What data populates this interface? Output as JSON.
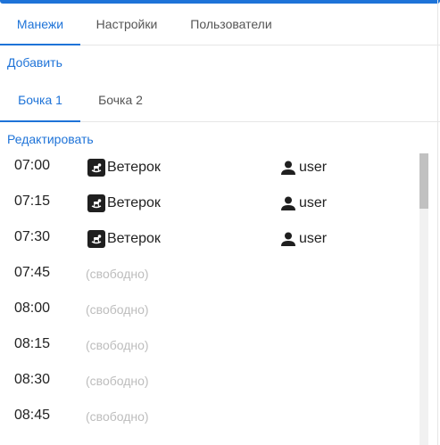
{
  "tabs_main": [
    {
      "label": "Манежи",
      "active": true
    },
    {
      "label": "Настройки",
      "active": false
    },
    {
      "label": "Пользователи",
      "active": false
    }
  ],
  "add_label": "Добавить",
  "tabs_sub": [
    {
      "label": "Бочка 1",
      "active": true
    },
    {
      "label": "Бочка 2",
      "active": false
    }
  ],
  "edit_label": "Редактировать",
  "slots": [
    {
      "time": "07:00",
      "horse": "Ветерок",
      "user": "user"
    },
    {
      "time": "07:15",
      "horse": "Ветерок",
      "user": "user"
    },
    {
      "time": "07:30",
      "horse": "Ветерок",
      "user": "user"
    },
    {
      "time": "07:45",
      "free": "(свободно)"
    },
    {
      "time": "08:00",
      "free": "(свободно)"
    },
    {
      "time": "08:15",
      "free": "(свободно)"
    },
    {
      "time": "08:30",
      "free": "(свободно)"
    },
    {
      "time": "08:45",
      "free": "(свободно)"
    }
  ],
  "icons": {
    "horse": "rocking-horse-icon",
    "user": "person-icon"
  },
  "colors": {
    "accent": "#1e73d8",
    "free_text": "#bdbdbd"
  }
}
